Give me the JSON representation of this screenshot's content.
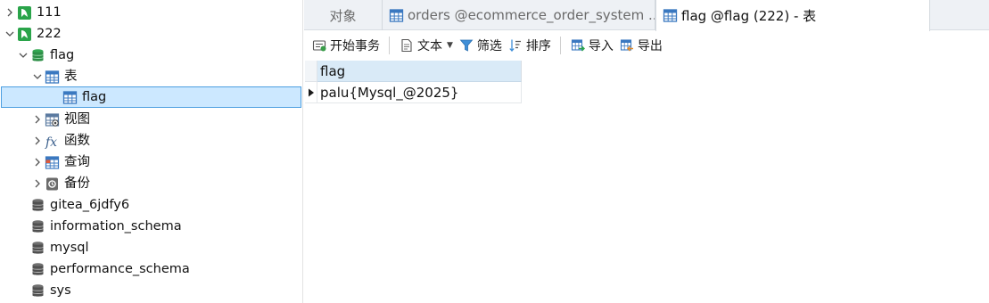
{
  "colors": {
    "selection_bg": "#cce8ff",
    "selection_border": "#4d9fe0",
    "server_icon_green": "#2aa44a",
    "database_icon_gray": "#505050",
    "database_open_green": "#34a853",
    "table_icon_blue": "#3a78c0",
    "column_header_bg": "#d9eaf7"
  },
  "navigator": {
    "items": [
      {
        "label": "111",
        "icon": "server-connection-icon",
        "chevron": "right"
      },
      {
        "label": "222",
        "icon": "server-connection-icon",
        "chevron": "down"
      },
      {
        "label": "flag",
        "icon": "database-open-icon",
        "chevron": "down"
      },
      {
        "label": "表",
        "icon": "table-folder-icon",
        "chevron": "down"
      },
      {
        "label": "flag",
        "icon": "table-icon",
        "chevron": "none",
        "selected": true
      },
      {
        "label": "视图",
        "icon": "view-icon",
        "chevron": "right"
      },
      {
        "label": "函数",
        "icon": "function-icon",
        "chevron": "right"
      },
      {
        "label": "查询",
        "icon": "query-icon",
        "chevron": "right"
      },
      {
        "label": "备份",
        "icon": "backup-icon",
        "chevron": "right"
      },
      {
        "label": "gitea_6jdfy6",
        "icon": "database-icon",
        "chevron": "none"
      },
      {
        "label": "information_schema",
        "icon": "database-icon",
        "chevron": "none"
      },
      {
        "label": "mysql",
        "icon": "database-icon",
        "chevron": "none"
      },
      {
        "label": "performance_schema",
        "icon": "database-icon",
        "chevron": "none"
      },
      {
        "label": "sys",
        "icon": "database-icon",
        "chevron": "none"
      }
    ]
  },
  "tabs": [
    {
      "label": "对象",
      "icon": "none",
      "active": false
    },
    {
      "label": "orders @ecommerce_order_system ...",
      "icon": "table-icon",
      "active": false
    },
    {
      "label": "flag @flag (222) - 表",
      "icon": "table-icon",
      "active": true
    }
  ],
  "toolbar": {
    "begin_transaction": "开始事务",
    "text": "文本",
    "filter": "筛选",
    "sort": "排序",
    "import": "导入",
    "export": "导出"
  },
  "grid": {
    "columns": [
      "flag"
    ],
    "rows": [
      [
        "palu{Mysql_@2025}"
      ]
    ]
  }
}
